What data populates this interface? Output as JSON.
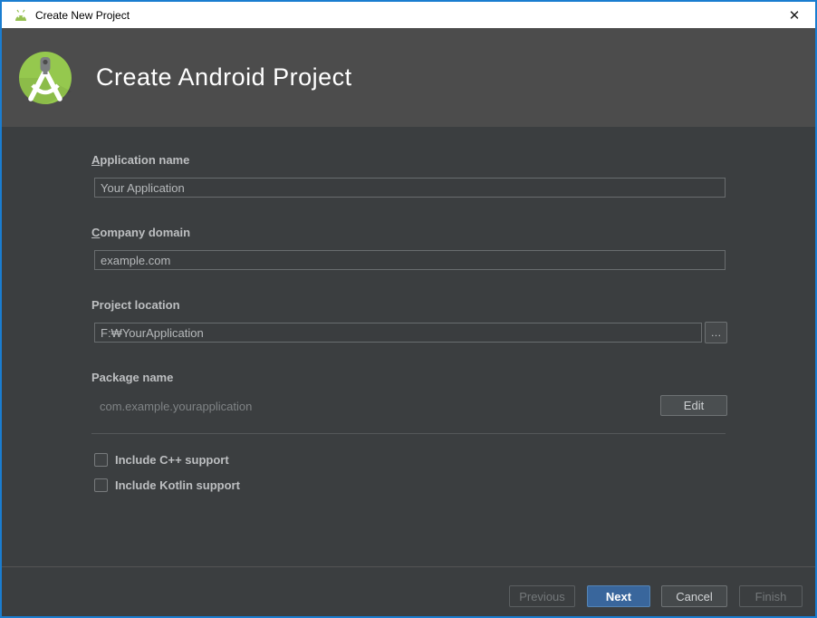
{
  "window": {
    "title": "Create New Project",
    "close_glyph": "✕"
  },
  "header": {
    "title": "Create Android Project"
  },
  "form": {
    "application_name": {
      "mnemonic": "A",
      "label_rest": "pplication name",
      "value": "Your Application"
    },
    "company_domain": {
      "mnemonic": "C",
      "label_rest": "ompany domain",
      "value": "example.com"
    },
    "project_location": {
      "label": "Project location",
      "value": "F:₩YourApplication",
      "browse_label": "…"
    },
    "package_name": {
      "label": "Package name",
      "value": "com.example.yourapplication",
      "edit_label": "Edit"
    },
    "checkboxes": [
      {
        "label": "Include C++ support",
        "checked": false
      },
      {
        "label": "Include Kotlin support",
        "checked": false
      }
    ]
  },
  "footer": {
    "previous_label": "Previous",
    "next_label": "Next",
    "cancel_label": "Cancel",
    "finish_label": "Finish"
  },
  "colors": {
    "window_border": "#1a7dd0",
    "titlebar_bg": "#ffffff",
    "header_bg": "#4c4c4c",
    "body_bg": "#3b3e40",
    "primary_button_bg": "#39669c",
    "android_green": "#95c84e"
  }
}
